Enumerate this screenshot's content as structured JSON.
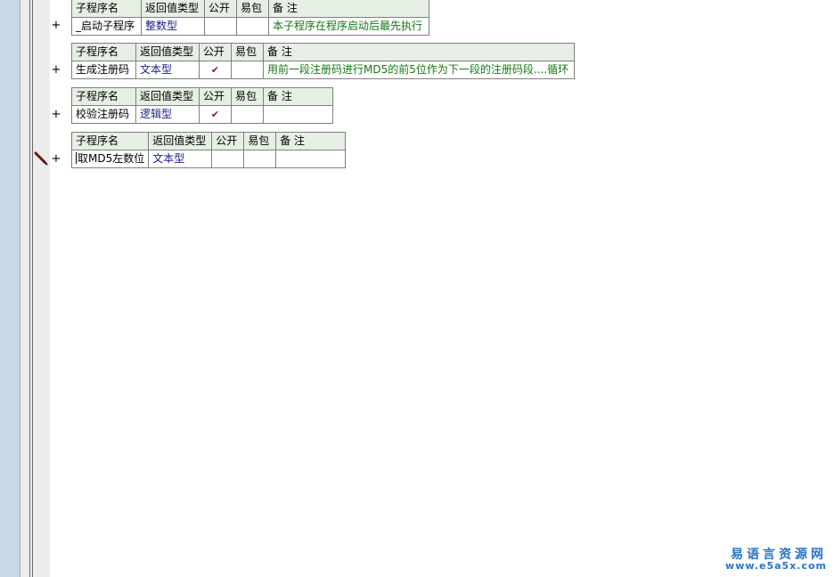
{
  "headers": {
    "name": "子程序名",
    "return_type": "返回值类型",
    "public": "公开",
    "easy_pack": "易包",
    "note": "备 注"
  },
  "subroutines": [
    {
      "name": "_启动子程序",
      "return_type": "整数型",
      "public": "",
      "easy_pack": "",
      "note": "本子程序在程序启动后最先执行"
    },
    {
      "name": "生成注册码",
      "return_type": "文本型",
      "public": "✔",
      "easy_pack": "",
      "note": "用前一段注册码进行MD5的前5位作为下一段的注册码段....循环"
    },
    {
      "name": "校验注册码",
      "return_type": "逻辑型",
      "public": "✔",
      "easy_pack": "",
      "note": ""
    },
    {
      "name": "取MD5左数位",
      "return_type": "文本型",
      "public": "",
      "easy_pack": "",
      "note": ""
    }
  ],
  "expand_symbol": "+",
  "watermark": {
    "line1": "易语言资源网",
    "line2": "www.e5a5x.com"
  },
  "colors": {
    "type_text": "#1b1b8c",
    "note_text": "#127812",
    "header_bg": "#e6efe4",
    "check": "#8b1a1a",
    "watermark": "#2a72c9"
  }
}
